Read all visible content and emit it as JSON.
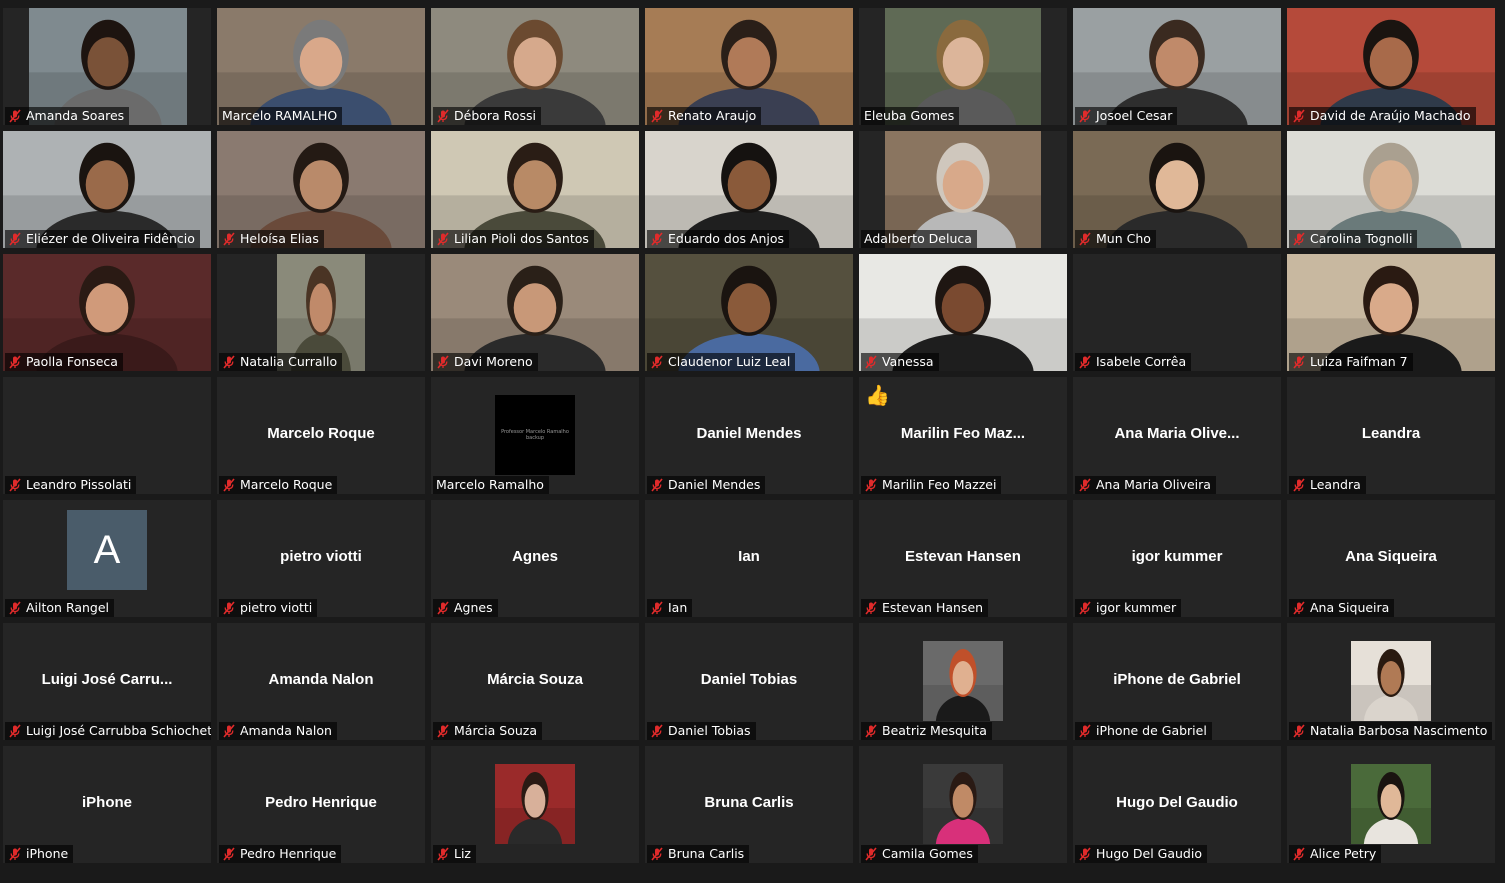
{
  "participants": [
    {
      "name": "Amanda Soares",
      "muted": true,
      "type": "video",
      "bg": "#7f8a8f",
      "skin": "#7a5238",
      "hair": "#1d1410",
      "shirt": "#6b6b6b",
      "vx": 26,
      "vw": 158
    },
    {
      "name": "Marcelo RAMALHO",
      "muted": false,
      "type": "video",
      "active": true,
      "bg": "#8a7a6a",
      "skin": "#d9a88a",
      "hair": "#7a7a7a",
      "shirt": "#3b4e6e",
      "vx": 0,
      "vw": 208
    },
    {
      "name": "Débora Rossi",
      "muted": true,
      "type": "video",
      "bg": "#8e8a7e",
      "skin": "#d6a98c",
      "hair": "#6b4a30",
      "shirt": "#3a3a3a",
      "vx": 0,
      "vw": 208
    },
    {
      "name": "Renato Araujo",
      "muted": true,
      "type": "video",
      "bg": "#a67c55",
      "skin": "#b07a58",
      "hair": "#2a1f18",
      "shirt": "#3a3f52",
      "vx": 0,
      "vw": 208
    },
    {
      "name": "Eleuba Gomes",
      "muted": false,
      "type": "video",
      "bg": "#5f6a55",
      "skin": "#dcb59a",
      "hair": "#8a6a3e",
      "shirt": "#5a5a5a",
      "vx": 26,
      "vw": 156
    },
    {
      "name": "Josoel Cesar",
      "muted": true,
      "type": "video",
      "bg": "#9aa0a2",
      "skin": "#c08a6a",
      "hair": "#3a2a20",
      "shirt": "#2e2e2e",
      "vx": 0,
      "vw": 208
    },
    {
      "name": "David de Araújo Machado",
      "muted": true,
      "type": "video",
      "bg": "#b54a3a",
      "skin": "#a86a4a",
      "hair": "#1a1410",
      "shirt": "#2f3a4a",
      "vx": 0,
      "vw": 208
    },
    {
      "name": "Eliézer de Oliveira Fidêncio",
      "muted": true,
      "type": "video",
      "bg": "#aeb2b4",
      "skin": "#9a6a4a",
      "hair": "#1a1410",
      "shirt": "#2a2a2a",
      "vx": 0,
      "vw": 208
    },
    {
      "name": "Heloísa Elias",
      "muted": true,
      "type": "video",
      "bg": "#8a7a70",
      "skin": "#b98a6a",
      "hair": "#241a14",
      "shirt": "#6a4a3a",
      "vx": 0,
      "vw": 208
    },
    {
      "name": "Lilian Pioli dos Santos",
      "muted": true,
      "type": "video",
      "bg": "#cfc8b4",
      "skin": "#b88a66",
      "hair": "#2a1d15",
      "shirt": "#4a4a3a",
      "vx": 0,
      "vw": 208
    },
    {
      "name": "Eduardo dos Anjos",
      "muted": true,
      "type": "video",
      "bg": "#d8d4cc",
      "skin": "#8a5a3a",
      "hair": "#151210",
      "shirt": "#1f1f1f",
      "vx": 0,
      "vw": 208
    },
    {
      "name": "Adalberto Deluca",
      "muted": false,
      "type": "video",
      "bg": "#8a7560",
      "skin": "#d8a98a",
      "hair": "#cfc7bd",
      "shirt": "#b8b8b8",
      "vx": 26,
      "vw": 156
    },
    {
      "name": "Mun Cho",
      "muted": true,
      "type": "video",
      "bg": "#7a6a55",
      "skin": "#e0b898",
      "hair": "#1a1410",
      "shirt": "#2a2a2a",
      "vx": 0,
      "vw": 208
    },
    {
      "name": "Carolina Tognolli",
      "muted": true,
      "type": "video",
      "bg": "#dcdcd6",
      "skin": "#d8b090",
      "hair": "#aaa090",
      "shirt": "#6a7a7a",
      "vx": 0,
      "vw": 208
    },
    {
      "name": "Paolla Fonseca",
      "muted": true,
      "type": "video",
      "bg": "#5a2a2a",
      "skin": "#d09a7a",
      "hair": "#2a1a14",
      "shirt": "#3a1a1a",
      "vx": 0,
      "vw": 208
    },
    {
      "name": "Natalia Currallo",
      "muted": true,
      "type": "video",
      "bg": "#8a8a7a",
      "skin": "#c08a6a",
      "hair": "#4a3424",
      "shirt": "#4a4a3a",
      "vx": 60,
      "vw": 88
    },
    {
      "name": "Davi Moreno",
      "muted": true,
      "type": "video",
      "bg": "#9a8a7a",
      "skin": "#c89878",
      "hair": "#2a2018",
      "shirt": "#2a2a2a",
      "vx": 0,
      "vw": 208
    },
    {
      "name": "Claudenor Luiz Leal",
      "muted": true,
      "type": "video",
      "bg": "#55503e",
      "skin": "#8a5a3a",
      "hair": "#1a1410",
      "shirt": "#4a6aa0",
      "vx": 0,
      "vw": 208
    },
    {
      "name": "Vanessa",
      "muted": true,
      "type": "video",
      "bg": "#e8e8e4",
      "skin": "#7a4a30",
      "hair": "#1e1612",
      "shirt": "#1e1e1e",
      "vx": 0,
      "vw": 208
    },
    {
      "name": "Isabele Corrêa",
      "muted": true,
      "type": "blank"
    },
    {
      "name": "Luiza Faifman 7",
      "muted": true,
      "type": "video",
      "bg": "#c8b8a0",
      "skin": "#d9aa8a",
      "hair": "#2a1a12",
      "shirt": "#1a1a1a",
      "vx": 0,
      "vw": 208
    },
    {
      "name": "Leandro Pissolati",
      "muted": true,
      "type": "blank"
    },
    {
      "name": "Marcelo Roque",
      "muted": true,
      "type": "text",
      "display": "Marcelo Roque"
    },
    {
      "name": "Marcelo Ramalho",
      "muted": false,
      "type": "backup",
      "backup_text": "Professor Marcelo Ramalho backup"
    },
    {
      "name": "Daniel Mendes",
      "muted": true,
      "type": "text",
      "display": "Daniel Mendes"
    },
    {
      "name": "Marilin Feo Mazzei",
      "muted": true,
      "type": "text",
      "display": "Marilin  Feo  Maz...",
      "reaction": "👍"
    },
    {
      "name": "Ana Maria Oliveira",
      "muted": true,
      "type": "text",
      "display": "Ana  Maria  Olive..."
    },
    {
      "name": "Leandra",
      "muted": true,
      "type": "text",
      "display": "Leandra"
    },
    {
      "name": "Ailton Rangel",
      "muted": true,
      "type": "letter",
      "letter": "A"
    },
    {
      "name": "pietro viotti",
      "muted": true,
      "type": "text",
      "display": "pietro viotti"
    },
    {
      "name": "Agnes",
      "muted": true,
      "type": "text",
      "display": "Agnes"
    },
    {
      "name": "Ian",
      "muted": true,
      "type": "text",
      "display": "Ian"
    },
    {
      "name": "Estevan Hansen",
      "muted": true,
      "type": "text",
      "display": "Estevan Hansen"
    },
    {
      "name": "igor kummer",
      "muted": true,
      "type": "text",
      "display": "igor kummer"
    },
    {
      "name": "Ana Siqueira",
      "muted": true,
      "type": "text",
      "display": "Ana Siqueira"
    },
    {
      "name": "Luigi José Carrubba Schiochet",
      "muted": true,
      "type": "text",
      "display": "Luigi  José  Carru..."
    },
    {
      "name": "Amanda Nalon",
      "muted": true,
      "type": "text",
      "display": "Amanda Nalon"
    },
    {
      "name": "Márcia Souza",
      "muted": true,
      "type": "text",
      "display": "Márcia Souza"
    },
    {
      "name": "Daniel Tobias",
      "muted": true,
      "type": "text",
      "display": "Daniel Tobias"
    },
    {
      "name": "Beatriz Mesquita",
      "muted": true,
      "type": "photo",
      "bg": "#6a6a6a",
      "skin": "#e0b090",
      "hair": "#c0502a",
      "shirt": "#1a1a1a"
    },
    {
      "name": "iPhone de Gabriel",
      "muted": true,
      "type": "text",
      "display": "iPhone de Gabriel"
    },
    {
      "name": "Natalia Barbosa Nascimento",
      "muted": true,
      "type": "photo",
      "bg": "#e6e0d8",
      "skin": "#b07a55",
      "hair": "#2a1a10",
      "shirt": "#dad4cc"
    },
    {
      "name": "iPhone",
      "muted": true,
      "type": "text",
      "display": "iPhone"
    },
    {
      "name": "Pedro Henrique",
      "muted": true,
      "type": "text",
      "display": "Pedro Henrique"
    },
    {
      "name": "Liz",
      "muted": true,
      "type": "photo",
      "bg": "#9a2a2a",
      "skin": "#d8b09a",
      "hair": "#2a1a14",
      "shirt": "#2a2a2a"
    },
    {
      "name": "Bruna Carlis",
      "muted": true,
      "type": "text",
      "display": "Bruna Carlis"
    },
    {
      "name": "Camila Gomes",
      "muted": true,
      "type": "photo",
      "bg": "#3a3a3a",
      "skin": "#c08a66",
      "hair": "#2a1a14",
      "shirt": "#d8307a"
    },
    {
      "name": "Hugo Del Gaudio",
      "muted": true,
      "type": "text",
      "display": "Hugo Del Gaudio"
    },
    {
      "name": "Alice Petry",
      "muted": true,
      "type": "photo",
      "bg": "#4a6a3a",
      "skin": "#e0b898",
      "hair": "#1a1410",
      "shirt": "#e8e4de"
    }
  ]
}
